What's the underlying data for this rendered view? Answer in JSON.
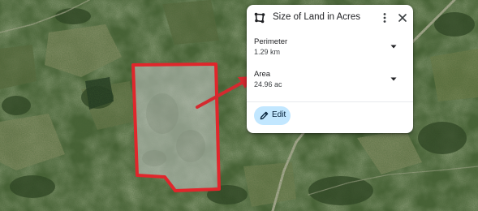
{
  "panel": {
    "title": "Size of Land in Acres",
    "tool_icon": "polygon-measure-icon",
    "more_icon": "more-vert-icon",
    "close_icon": "close-icon"
  },
  "measurements": {
    "perimeter": {
      "label": "Perimeter",
      "value": "1.29 km"
    },
    "area": {
      "label": "Area",
      "value": "24.96 ac"
    }
  },
  "edit": {
    "label": "Edit",
    "icon": "pencil-icon"
  },
  "colors": {
    "boundary": "#e0262b",
    "arrow": "#d42a2f",
    "button_bg": "#c2e7ff"
  }
}
